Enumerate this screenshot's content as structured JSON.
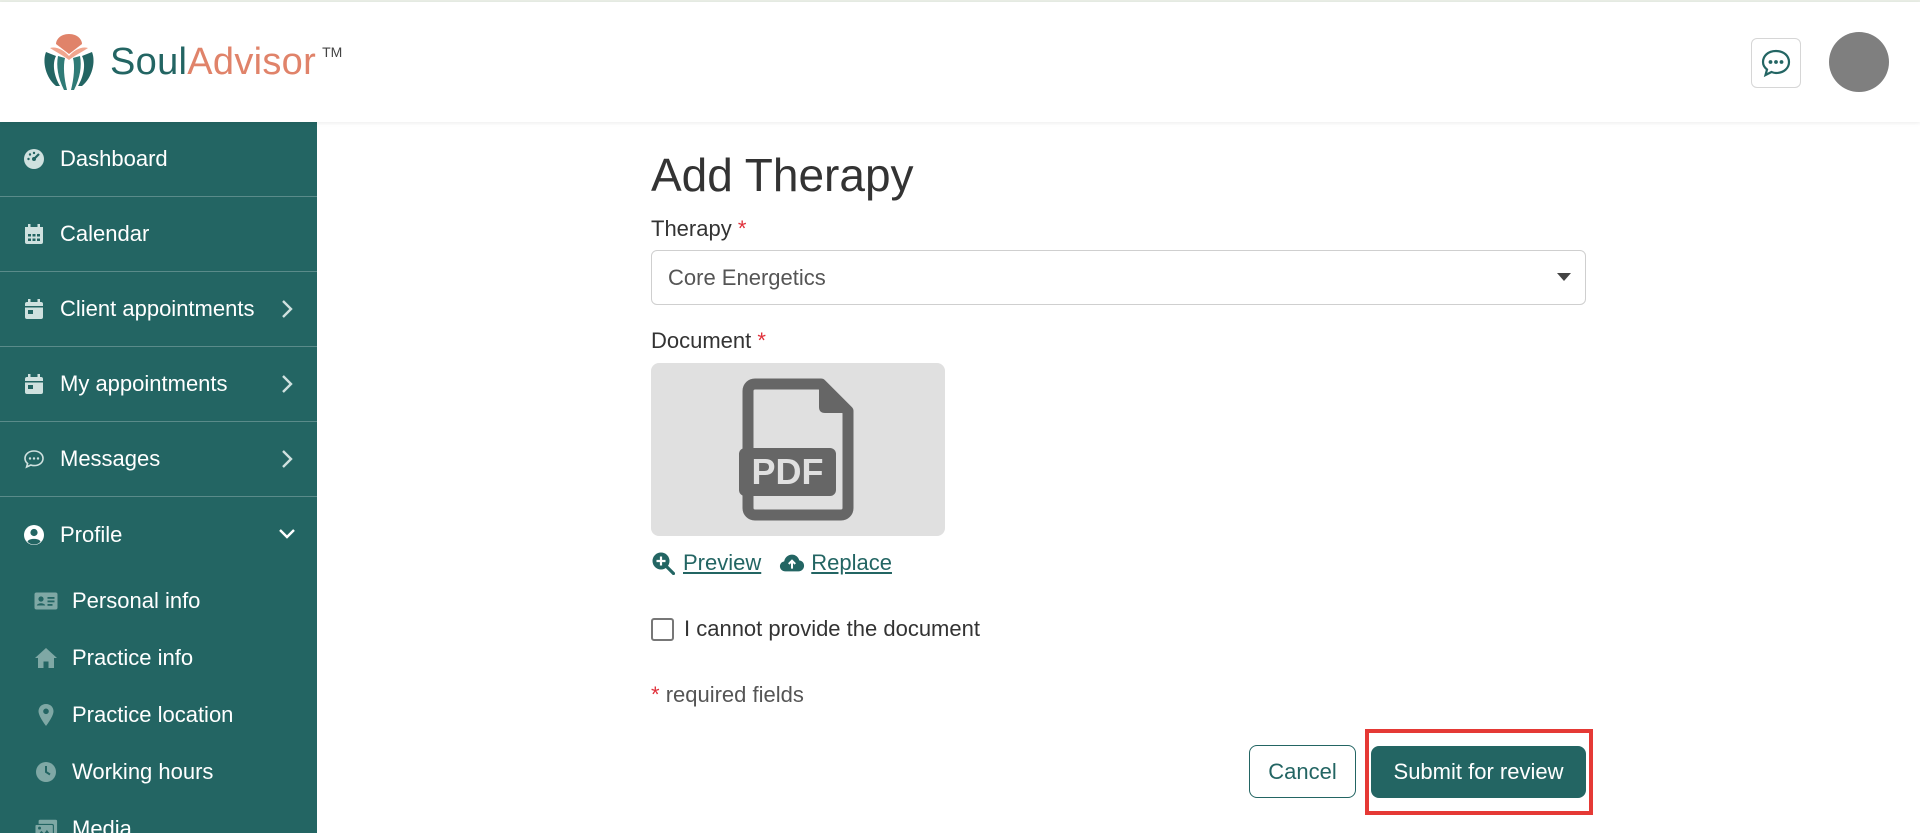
{
  "brand": {
    "name_part1": "Soul",
    "name_part2": "Advisor",
    "trademark": "TM"
  },
  "colors": {
    "primary": "#236563",
    "accent": "#e0836a",
    "required": "#e0303a",
    "highlight": "#e53935"
  },
  "header": {
    "chat_icon": "chat-bubble-icon",
    "avatar_icon": "avatar"
  },
  "sidebar": {
    "items": [
      {
        "label": "Dashboard",
        "icon": "dashboard-gauge-icon"
      },
      {
        "label": "Calendar",
        "icon": "calendar-icon"
      },
      {
        "label": "Client appointments",
        "icon": "calendar-day-icon"
      },
      {
        "label": "My appointments",
        "icon": "calendar-day-icon"
      },
      {
        "label": "Messages",
        "icon": "chat-icon"
      },
      {
        "label": "Profile",
        "icon": "user-circle-icon"
      }
    ],
    "profile_sub": [
      {
        "label": "Personal info",
        "icon": "id-card-icon"
      },
      {
        "label": "Practice info",
        "icon": "home-icon"
      },
      {
        "label": "Practice location",
        "icon": "map-pin-icon"
      },
      {
        "label": "Working hours",
        "icon": "clock-icon"
      },
      {
        "label": "Media",
        "icon": "images-icon"
      }
    ]
  },
  "form": {
    "title": "Add Therapy",
    "therapy_label": "Therapy",
    "required_mark": "*",
    "therapy_value": "Core Energetics",
    "document_label": "Document",
    "doc_badge": "PDF",
    "preview_label": "Preview",
    "replace_label": "Replace",
    "checkbox_label": "I cannot provide the document",
    "checkbox_checked": false,
    "required_note": "required fields",
    "cancel_label": "Cancel",
    "submit_label": "Submit for review"
  }
}
